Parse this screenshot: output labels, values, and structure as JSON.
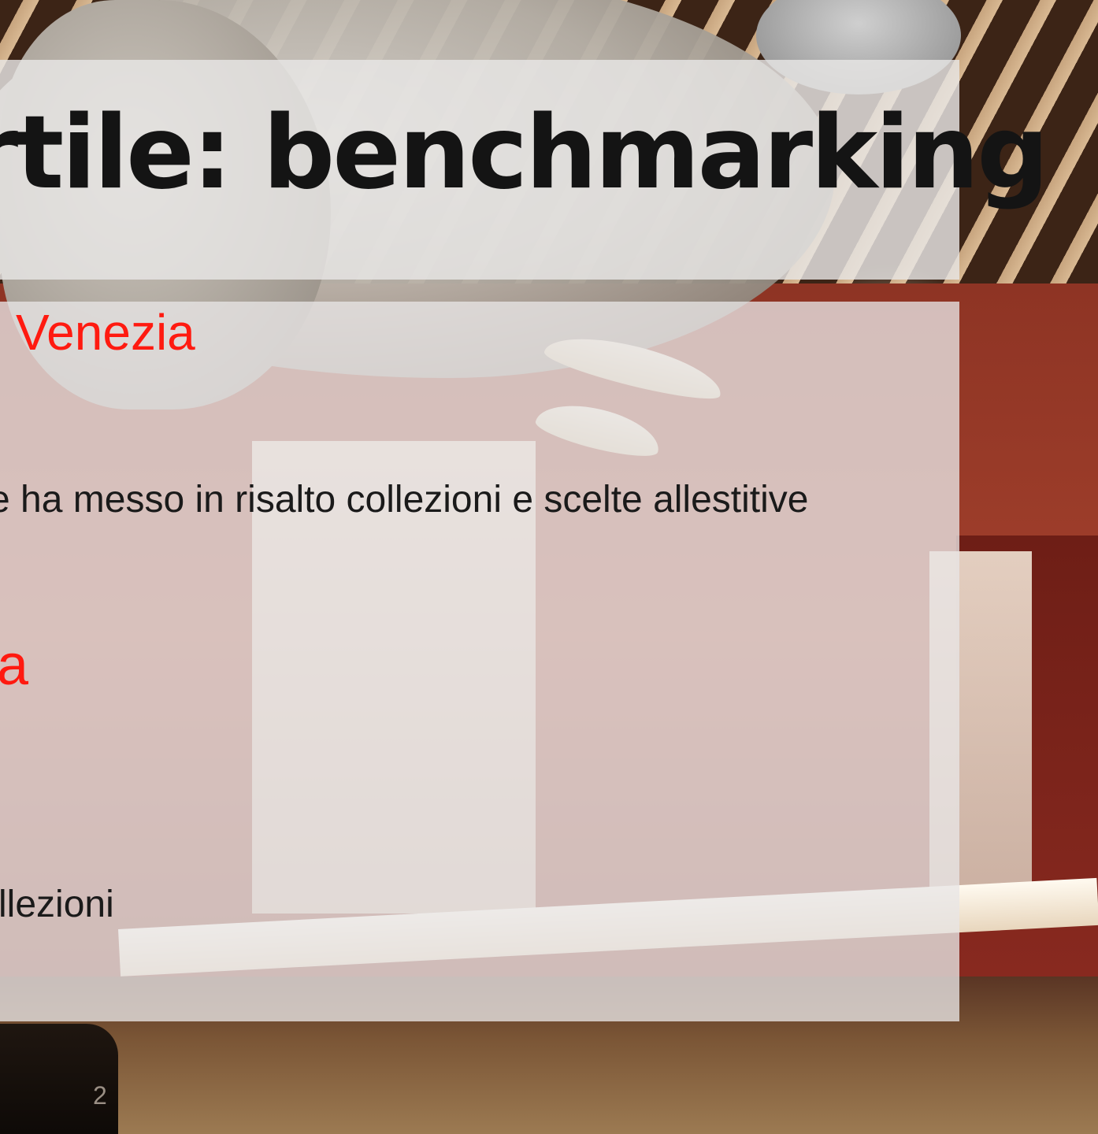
{
  "slide": {
    "title": "rtile: benchmarking",
    "section_1": {
      "heading": "Venezia",
      "body": "e ha messo in risalto collezioni e scelte allestitive"
    },
    "section_2": {
      "heading": "a",
      "body": "llezioni"
    },
    "page_number": "2"
  },
  "colors": {
    "title_text": "#141414",
    "accent_red": "#ff1a10",
    "body_text": "#1a1a1a",
    "overlay": "#e8e6e5"
  }
}
